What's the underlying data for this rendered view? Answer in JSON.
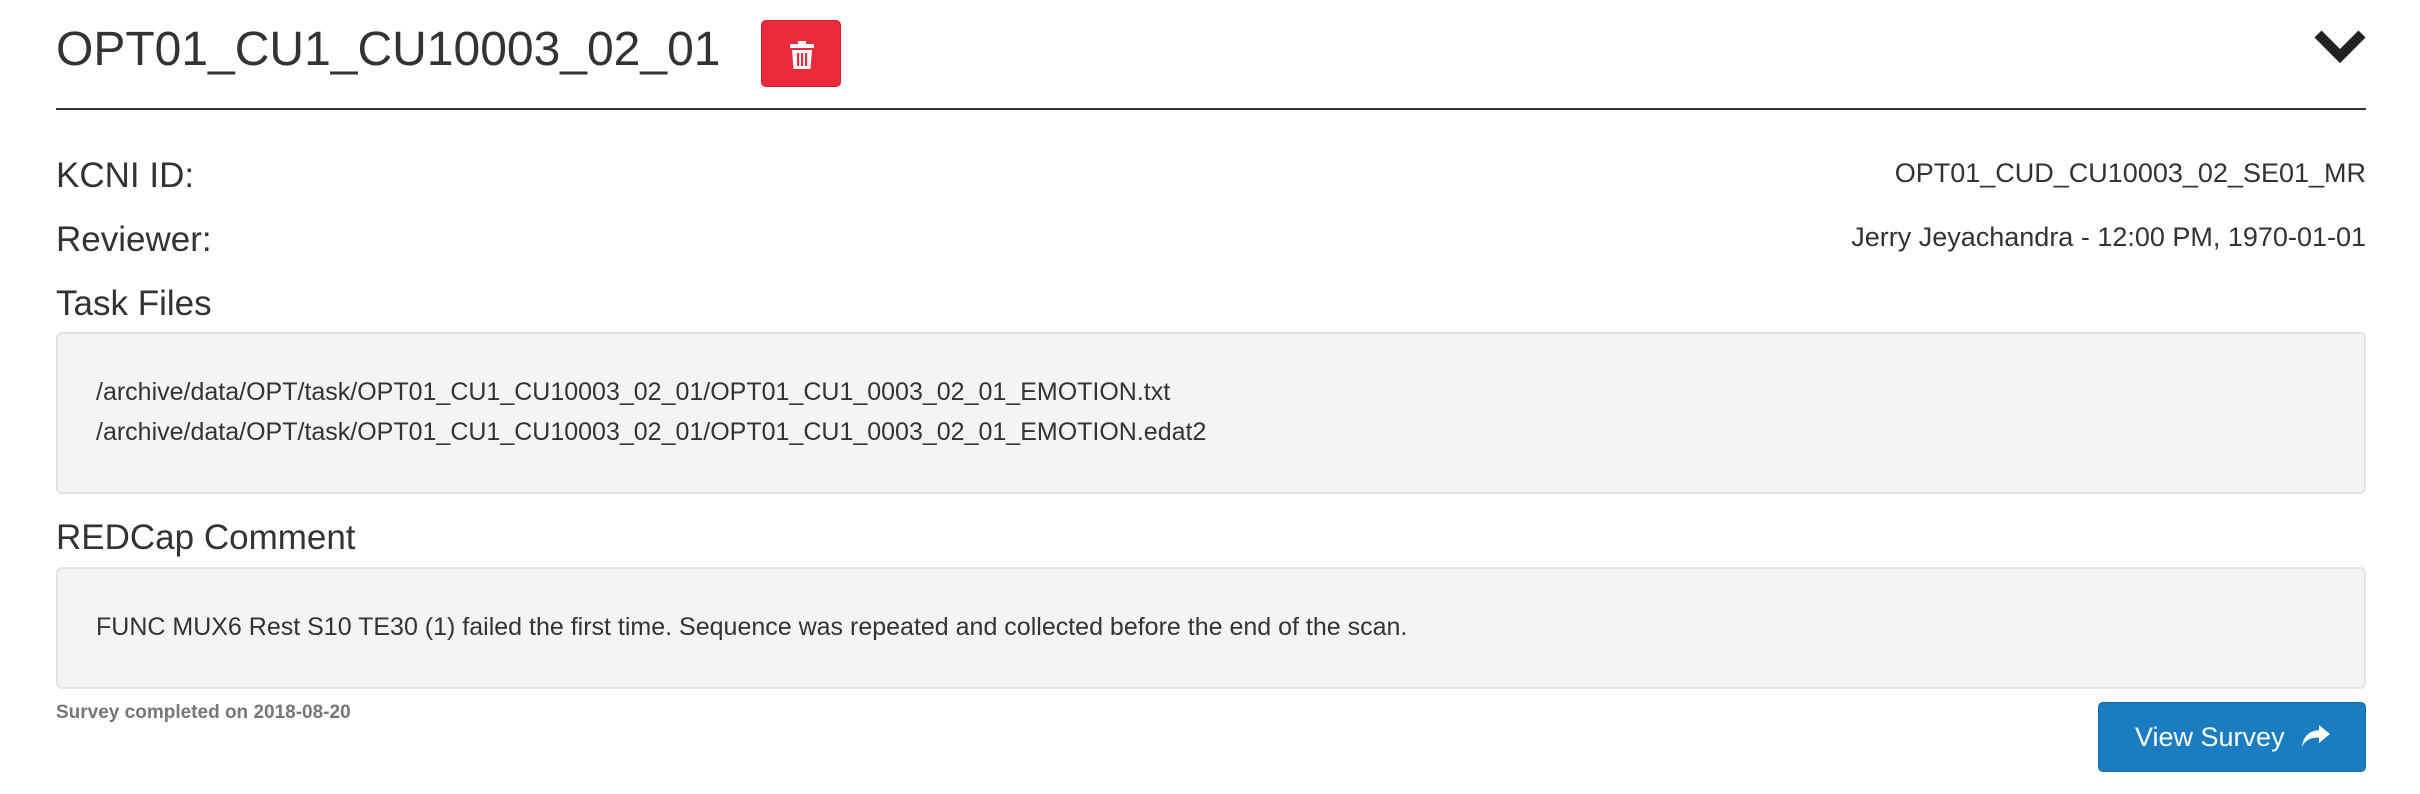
{
  "header": {
    "title": "OPT01_CU1_CU10003_02_01",
    "delete_icon": "trash-icon",
    "toggle_icon": "chevron-down-icon"
  },
  "details": {
    "kcni_id_label": "KCNI ID:",
    "kcni_id_value": "OPT01_CUD_CU10003_02_SE01_MR",
    "reviewer_label": "Reviewer:",
    "reviewer_value": "Jerry Jeyachandra - 12:00 PM, 1970-01-01"
  },
  "task_files": {
    "heading": "Task Files",
    "files": [
      "/archive/data/OPT/task/OPT01_CU1_CU10003_02_01/OPT01_CU1_0003_02_01_EMOTION.txt",
      "/archive/data/OPT/task/OPT01_CU1_CU10003_02_01/OPT01_CU1_0003_02_01_EMOTION.edat2"
    ]
  },
  "redcap": {
    "heading": "REDCap Comment",
    "comment": "FUNC MUX6 Rest S10 TE30 (1) failed the first time. Sequence was repeated and collected before the end of the scan.",
    "survey_note": "Survey completed on 2018-08-20",
    "view_survey_label": "View Survey",
    "view_survey_icon": "share-arrow-icon"
  },
  "colors": {
    "danger": "#ea2b3b",
    "primary": "#1a7dc2",
    "well_bg": "#f4f4f4",
    "text": "#333333"
  }
}
